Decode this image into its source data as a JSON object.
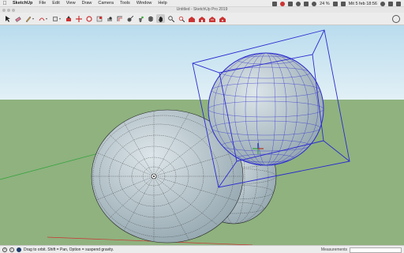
{
  "menubar": {
    "apple": "",
    "app_name": "SketchUp",
    "items": [
      "File",
      "Edit",
      "View",
      "Draw",
      "Camera",
      "Tools",
      "Window",
      "Help"
    ],
    "battery": "24 %",
    "clock": "Mit 5 feb 18:56"
  },
  "window": {
    "title": "Untitled - SketchUp Pro 2019"
  },
  "toolbar": {
    "tools": [
      "select-tool",
      "eraser-tool",
      "line-tool",
      "rectangle-tool",
      "push-pull-tool",
      "move-tool",
      "rotate-tool",
      "scale-tool",
      "follow-me-tool",
      "offset-tool",
      "tape-measure-tool",
      "paint-bucket-tool",
      "orbit-tool",
      "pan-tool",
      "zoom-tool",
      "zoom-extents-tool",
      "warehouse-tool",
      "extension-warehouse-tool",
      "layout-tool",
      "extension-manager-tool"
    ]
  },
  "scene": {
    "sky_color": "#cfe6f0",
    "ground_color": "#8fb27f",
    "sphere_color": "#b9c8cf",
    "selection_color": "#2a2ad0"
  },
  "statusbar": {
    "hint": "Drag to orbit. Shift = Pan, Option = suspend gravity.",
    "measurements_label": "Measurements",
    "measurements_value": ""
  }
}
